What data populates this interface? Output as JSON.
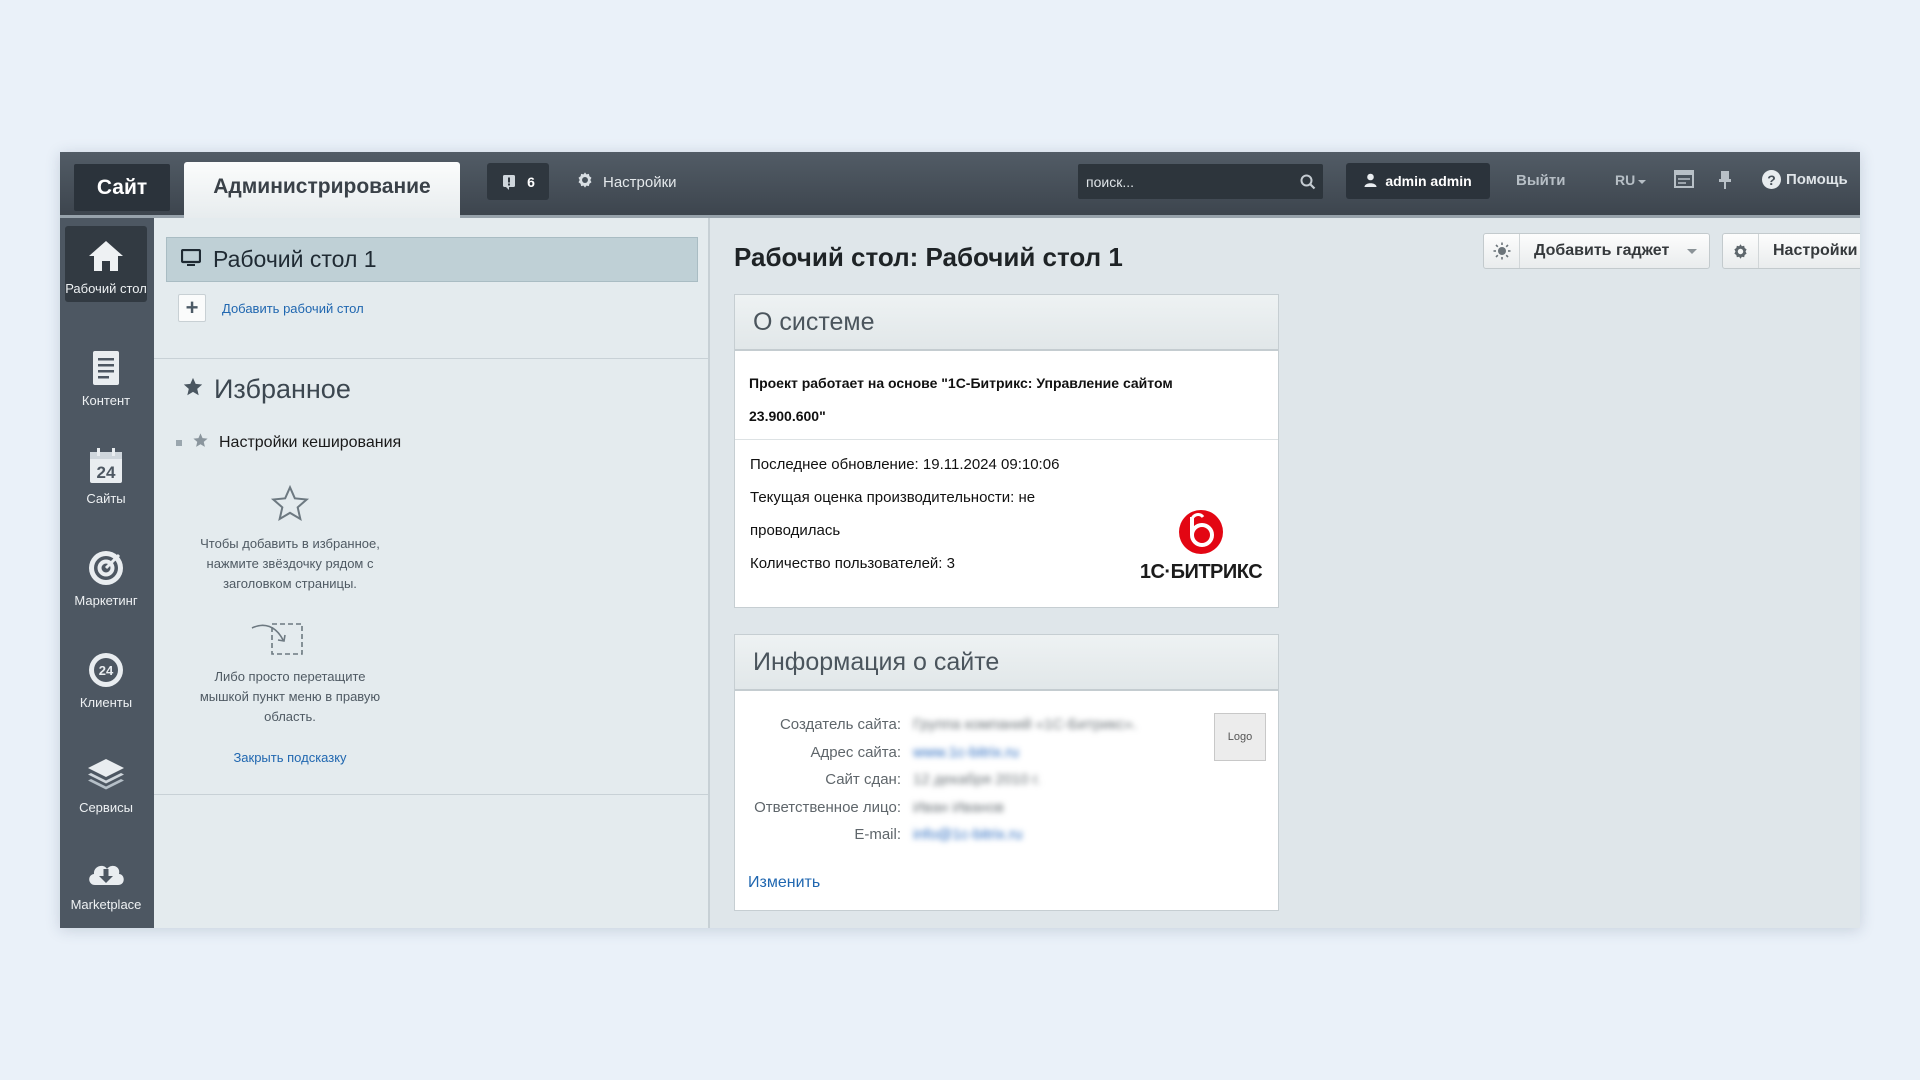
{
  "topbar": {
    "tab_site": "Сайт",
    "tab_admin": "Администрирование",
    "notifications_count": "6",
    "settings_label": "Настройки",
    "search_placeholder": "поиск...",
    "user_name": "admin admin",
    "logout_label": "Выйти",
    "language": "RU",
    "help_label": "Помощь"
  },
  "sidebar": {
    "items": [
      {
        "label": "Рабочий стол",
        "icon": "home-icon"
      },
      {
        "label": "Контент",
        "icon": "document-icon"
      },
      {
        "label": "Сайты",
        "icon": "calendar-24-icon"
      },
      {
        "label": "Маркетинг",
        "icon": "target-icon"
      },
      {
        "label": "Клиенты",
        "icon": "clients-24-icon"
      },
      {
        "label": "Сервисы",
        "icon": "layers-icon"
      },
      {
        "label": "Marketplace",
        "icon": "cloud-download-icon"
      }
    ]
  },
  "desktops": {
    "active": "Рабочий стол 1",
    "add_label": "Добавить рабочий стол"
  },
  "favorites": {
    "title": "Избранное",
    "items": [
      "Настройки кеширования"
    ],
    "hint_star": "Чтобы добавить в избранное, нажмите звёздочку рядом с заголовком страницы.",
    "hint_drag": "Либо просто перетащите мышкой пункт меню в правую область.",
    "close_hint": "Закрыть подсказку"
  },
  "main": {
    "title": "Рабочий стол: Рабочий стол 1",
    "add_gadget": "Добавить гаджет",
    "settings": "Настройки"
  },
  "system_gadget": {
    "title": "О системе",
    "line1": "Проект работает на основе \"1С-Битрикс: Управление сайтом",
    "line2": "23.900.600\"",
    "last_update": "Последнее обновление: 19.11.2024 09:10:06",
    "perf1": "Текущая оценка производительности: не",
    "perf2": "проводилась",
    "users": "Количество пользователей: 3",
    "logo_text": "1С·БИТРИКС",
    "logo_color": "#e30613"
  },
  "site_gadget": {
    "title": "Информация о сайте",
    "rows": [
      {
        "label": "Создатель сайта:",
        "value": "Группа компаний «1С-Битрикс»."
      },
      {
        "label": "Адрес сайта:",
        "value": "www.1c-bitrix.ru"
      },
      {
        "label": "Сайт сдан:",
        "value": "12 декабря 2010 г."
      },
      {
        "label": "Ответственное лицо:",
        "value": "Иван Иванов"
      },
      {
        "label": "E-mail:",
        "value": "info@1c-bitrix.ru"
      }
    ],
    "logo_placeholder": "Logo",
    "edit_label": "Изменить"
  }
}
